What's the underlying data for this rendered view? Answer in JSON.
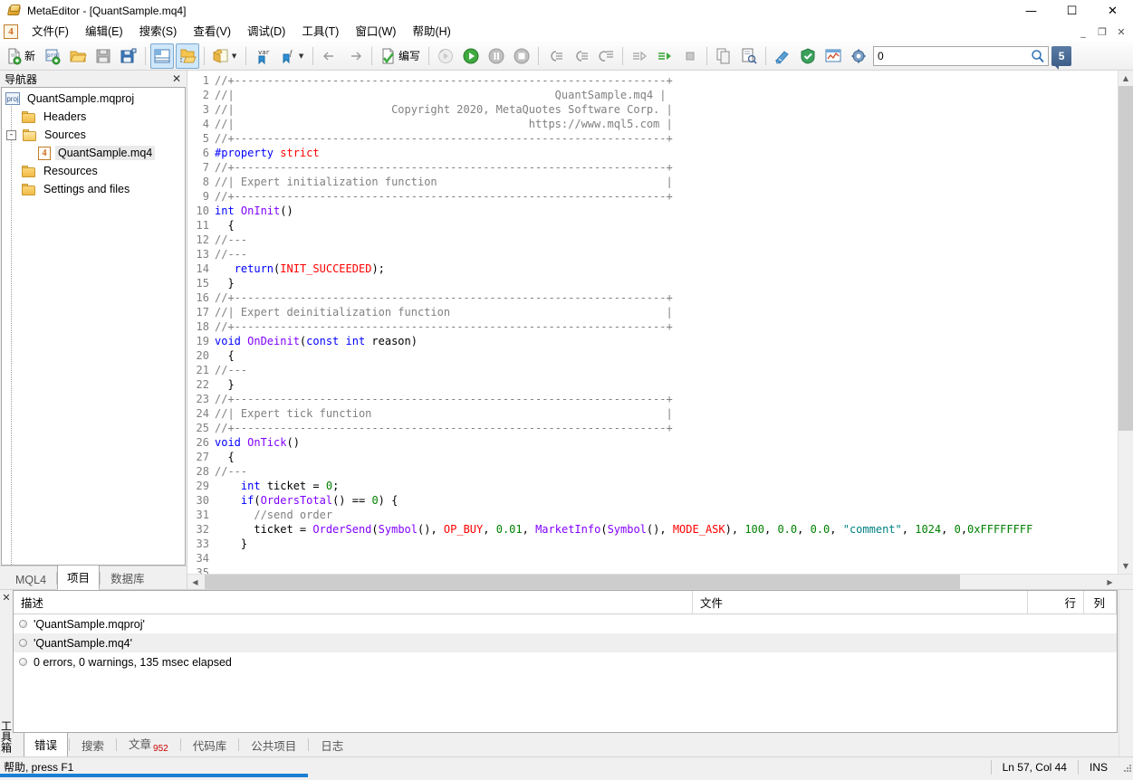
{
  "window": {
    "title": "MetaEditor - [QuantSample.mq4]",
    "app_icon": "folder-gold-icon",
    "minimize": "—",
    "maximize": "☐",
    "close": "✕"
  },
  "mdi_controls": {
    "minimize": "_",
    "restore": "❐",
    "close": "✕"
  },
  "menu": {
    "logo": "4",
    "items": [
      {
        "label": "文件(F)",
        "name": "menu-file"
      },
      {
        "label": "编辑(E)",
        "name": "menu-edit"
      },
      {
        "label": "搜索(S)",
        "name": "menu-search"
      },
      {
        "label": "查看(V)",
        "name": "menu-view"
      },
      {
        "label": "调试(D)",
        "name": "menu-debug"
      },
      {
        "label": "工具(T)",
        "name": "menu-tools"
      },
      {
        "label": "窗口(W)",
        "name": "menu-window"
      },
      {
        "label": "帮助(H)",
        "name": "menu-help"
      }
    ]
  },
  "toolbar": {
    "new_label": "新",
    "compile_label": "编写",
    "buttons": [
      {
        "name": "new-file-icon",
        "tip": "新"
      },
      {
        "name": "new-project-icon",
        "tip": "proj"
      },
      {
        "name": "open-folder-icon",
        "tip": "Open"
      },
      {
        "name": "save-icon",
        "tip": "Save"
      },
      {
        "name": "save-all-icon",
        "tip": "Save All"
      },
      {
        "name": "toggle-navigator-icon",
        "tip": "Navigator"
      },
      {
        "name": "toggle-toolbox-icon",
        "tip": "Toolbox"
      },
      {
        "name": "notes-icon",
        "tip": "Notes"
      },
      {
        "name": "variable-bookmark-icon",
        "tip": "var"
      },
      {
        "name": "function-bookmark-icon",
        "tip": "f"
      },
      {
        "name": "back-arrow-icon",
        "tip": "Back"
      },
      {
        "name": "forward-arrow-icon",
        "tip": "Forward"
      },
      {
        "name": "compile-icon",
        "tip": "编写"
      },
      {
        "name": "restart-debug-icon",
        "tip": "Restart"
      },
      {
        "name": "start-debug-icon",
        "tip": "Start"
      },
      {
        "name": "pause-debug-icon",
        "tip": "Pause"
      },
      {
        "name": "stop-debug-icon",
        "tip": "Stop"
      },
      {
        "name": "step-into-icon",
        "tip": "Step Into"
      },
      {
        "name": "step-over-icon",
        "tip": "Step Over"
      },
      {
        "name": "step-out-icon",
        "tip": "Step Out"
      },
      {
        "name": "run-to-cursor-icon",
        "tip": "Run to Cursor"
      },
      {
        "name": "run-green-icon",
        "tip": "Run"
      },
      {
        "name": "stop-square-icon",
        "tip": "Stop"
      },
      {
        "name": "copy-page-icon",
        "tip": "Copy"
      },
      {
        "name": "preview-icon",
        "tip": "Preview"
      },
      {
        "name": "style-icon",
        "tip": "Style"
      },
      {
        "name": "protect-icon",
        "tip": "Protect"
      },
      {
        "name": "chart-window-icon",
        "tip": "Chart"
      },
      {
        "name": "settings-gear-icon",
        "tip": "Settings"
      }
    ],
    "search": {
      "value": "0",
      "placeholder": "",
      "go_icon": "magnifier-icon"
    },
    "badge": "5"
  },
  "navigator": {
    "header": "导航器",
    "close": "✕",
    "tree": [
      {
        "label": "QuantSample.mqproj",
        "icon": "project-icon",
        "level": 0,
        "selected": false
      },
      {
        "label": "Headers",
        "icon": "folder-icon",
        "level": 1,
        "selected": false
      },
      {
        "label": "Sources",
        "icon": "folder-open-icon",
        "level": 1,
        "selected": false,
        "expander": "-"
      },
      {
        "label": "QuantSample.mq4",
        "icon": "mq4-icon",
        "level": 2,
        "selected": true
      },
      {
        "label": "Resources",
        "icon": "folder-icon",
        "level": 1,
        "selected": false
      },
      {
        "label": "Settings and files",
        "icon": "folder-icon",
        "level": 1,
        "selected": false
      }
    ],
    "tabs": [
      {
        "label": "MQL4",
        "active": false
      },
      {
        "label": "项目",
        "active": true
      },
      {
        "label": "数据库",
        "active": false
      }
    ]
  },
  "editor": {
    "lines": [
      {
        "n": 1,
        "tokens": [
          {
            "t": "//+------------------------------------------------------------------+",
            "c": "cm"
          }
        ]
      },
      {
        "n": 2,
        "tokens": [
          {
            "t": "//|                                                 QuantSample.mq4 |",
            "c": "cm"
          }
        ]
      },
      {
        "n": 3,
        "tokens": [
          {
            "t": "//|                        Copyright 2020, MetaQuotes Software Corp. |",
            "c": "cm"
          }
        ]
      },
      {
        "n": 4,
        "tokens": [
          {
            "t": "//|                                             https://www.mql5.com |",
            "c": "cm"
          }
        ]
      },
      {
        "n": 5,
        "tokens": [
          {
            "t": "//+------------------------------------------------------------------+",
            "c": "cm"
          }
        ]
      },
      {
        "n": 6,
        "tokens": [
          {
            "t": "#property ",
            "c": "pp"
          },
          {
            "t": "strict",
            "c": "cst"
          }
        ]
      },
      {
        "n": 7,
        "tokens": [
          {
            "t": "//+------------------------------------------------------------------+",
            "c": "cm"
          }
        ]
      },
      {
        "n": 8,
        "tokens": [
          {
            "t": "//| Expert initialization function                                   |",
            "c": "cm"
          }
        ]
      },
      {
        "n": 9,
        "tokens": [
          {
            "t": "//+------------------------------------------------------------------+",
            "c": "cm"
          }
        ]
      },
      {
        "n": 10,
        "tokens": [
          {
            "t": "int ",
            "c": "kw"
          },
          {
            "t": "OnInit",
            "c": "fn"
          },
          {
            "t": "()",
            "c": "op"
          }
        ]
      },
      {
        "n": 11,
        "tokens": [
          {
            "t": "  {",
            "c": "op"
          }
        ]
      },
      {
        "n": 12,
        "tokens": [
          {
            "t": "//---",
            "c": "cm"
          }
        ]
      },
      {
        "n": 13,
        "tokens": [
          {
            "t": "",
            "c": "op"
          }
        ]
      },
      {
        "n": 14,
        "tokens": [
          {
            "t": "//---",
            "c": "cm"
          }
        ]
      },
      {
        "n": 15,
        "tokens": [
          {
            "t": "   ",
            "c": "op"
          },
          {
            "t": "return",
            "c": "kw"
          },
          {
            "t": "(",
            "c": "op"
          },
          {
            "t": "INIT_SUCCEEDED",
            "c": "cst"
          },
          {
            "t": ");",
            "c": "op"
          }
        ]
      },
      {
        "n": 16,
        "tokens": [
          {
            "t": "  }",
            "c": "op"
          }
        ]
      },
      {
        "n": 17,
        "tokens": [
          {
            "t": "//+------------------------------------------------------------------+",
            "c": "cm"
          }
        ]
      },
      {
        "n": 18,
        "tokens": [
          {
            "t": "//| Expert deinitialization function                                 |",
            "c": "cm"
          }
        ]
      },
      {
        "n": 19,
        "tokens": [
          {
            "t": "//+------------------------------------------------------------------+",
            "c": "cm"
          }
        ]
      },
      {
        "n": 20,
        "tokens": [
          {
            "t": "void ",
            "c": "kw"
          },
          {
            "t": "OnDeinit",
            "c": "fn"
          },
          {
            "t": "(",
            "c": "op"
          },
          {
            "t": "const int ",
            "c": "kw"
          },
          {
            "t": "reason)",
            "c": "op"
          }
        ]
      },
      {
        "n": 21,
        "tokens": [
          {
            "t": "  {",
            "c": "op"
          }
        ]
      },
      {
        "n": 22,
        "tokens": [
          {
            "t": "//---",
            "c": "cm"
          }
        ]
      },
      {
        "n": 23,
        "tokens": [
          {
            "t": "",
            "c": "op"
          }
        ]
      },
      {
        "n": 24,
        "tokens": [
          {
            "t": "  }",
            "c": "op"
          }
        ]
      },
      {
        "n": 25,
        "tokens": [
          {
            "t": "//+------------------------------------------------------------------+",
            "c": "cm"
          }
        ]
      },
      {
        "n": 26,
        "tokens": [
          {
            "t": "//| Expert tick function                                             |",
            "c": "cm"
          }
        ]
      },
      {
        "n": 27,
        "tokens": [
          {
            "t": "//+------------------------------------------------------------------+",
            "c": "cm"
          }
        ]
      },
      {
        "n": 28,
        "tokens": [
          {
            "t": "void ",
            "c": "kw"
          },
          {
            "t": "OnTick",
            "c": "fn"
          },
          {
            "t": "()",
            "c": "op"
          }
        ]
      },
      {
        "n": 29,
        "tokens": [
          {
            "t": "  {",
            "c": "op"
          }
        ]
      },
      {
        "n": 30,
        "tokens": [
          {
            "t": "//---",
            "c": "cm"
          }
        ]
      },
      {
        "n": 31,
        "tokens": [
          {
            "t": "    ",
            "c": "op"
          },
          {
            "t": "int ",
            "c": "kw"
          },
          {
            "t": "ticket = ",
            "c": "op"
          },
          {
            "t": "0",
            "c": "num"
          },
          {
            "t": ";",
            "c": "op"
          }
        ]
      },
      {
        "n": 32,
        "tokens": [
          {
            "t": "    ",
            "c": "op"
          },
          {
            "t": "if",
            "c": "kw"
          },
          {
            "t": "(",
            "c": "op"
          },
          {
            "t": "OrdersTotal",
            "c": "fn"
          },
          {
            "t": "() == ",
            "c": "op"
          },
          {
            "t": "0",
            "c": "num"
          },
          {
            "t": ") {",
            "c": "op"
          }
        ]
      },
      {
        "n": 33,
        "tokens": [
          {
            "t": "      //send order",
            "c": "cm"
          }
        ]
      },
      {
        "n": 34,
        "tokens": [
          {
            "t": "      ticket = ",
            "c": "op"
          },
          {
            "t": "OrderSend",
            "c": "fn"
          },
          {
            "t": "(",
            "c": "op"
          },
          {
            "t": "Symbol",
            "c": "fn"
          },
          {
            "t": "(), ",
            "c": "op"
          },
          {
            "t": "OP_BUY",
            "c": "cst"
          },
          {
            "t": ", ",
            "c": "op"
          },
          {
            "t": "0.01",
            "c": "num"
          },
          {
            "t": ", ",
            "c": "op"
          },
          {
            "t": "MarketInfo",
            "c": "fn"
          },
          {
            "t": "(",
            "c": "op"
          },
          {
            "t": "Symbol",
            "c": "fn"
          },
          {
            "t": "(), ",
            "c": "op"
          },
          {
            "t": "MODE_ASK",
            "c": "cst"
          },
          {
            "t": "), ",
            "c": "op"
          },
          {
            "t": "100",
            "c": "num"
          },
          {
            "t": ", ",
            "c": "op"
          },
          {
            "t": "0.0",
            "c": "num"
          },
          {
            "t": ", ",
            "c": "op"
          },
          {
            "t": "0.0",
            "c": "num"
          },
          {
            "t": ", ",
            "c": "op"
          },
          {
            "t": "\"comment\"",
            "c": "str"
          },
          {
            "t": ", ",
            "c": "op"
          },
          {
            "t": "1024",
            "c": "num"
          },
          {
            "t": ", ",
            "c": "op"
          },
          {
            "t": "0",
            "c": "num"
          },
          {
            "t": ",",
            "c": "op"
          },
          {
            "t": "0xFFFFFFFF",
            "c": "num"
          }
        ]
      },
      {
        "n": 35,
        "tokens": [
          {
            "t": "    }",
            "c": "op"
          }
        ]
      }
    ]
  },
  "toolbox": {
    "close": "✕",
    "side_label": "工具箱",
    "columns": [
      "描述",
      "文件",
      "行",
      "列"
    ],
    "rows": [
      {
        "desc": "'QuantSample.mqproj'",
        "file": "",
        "line": "",
        "col": ""
      },
      {
        "desc": "'QuantSample.mq4'",
        "file": "",
        "line": "",
        "col": ""
      },
      {
        "desc": "0 errors, 0 warnings, 135 msec elapsed",
        "file": "",
        "line": "",
        "col": ""
      }
    ],
    "tabs": [
      {
        "label": "错误",
        "active": true,
        "count": ""
      },
      {
        "label": "搜索",
        "active": false,
        "count": ""
      },
      {
        "label": "文章",
        "active": false,
        "count": "952"
      },
      {
        "label": "代码库",
        "active": false,
        "count": ""
      },
      {
        "label": "公共项目",
        "active": false,
        "count": ""
      },
      {
        "label": "日志",
        "active": false,
        "count": ""
      }
    ]
  },
  "statusbar": {
    "help": "帮助, press F1",
    "position": "Ln 57, Col 44",
    "insert_mode": "INS"
  },
  "colors": {
    "accent": "#1a7fd4",
    "comment": "#808080",
    "keyword": "#0000ff",
    "function": "#8000ff",
    "constant": "#ff0000",
    "number": "#008000",
    "string": "#008080",
    "toolbar_active": "#cfe7fb"
  }
}
